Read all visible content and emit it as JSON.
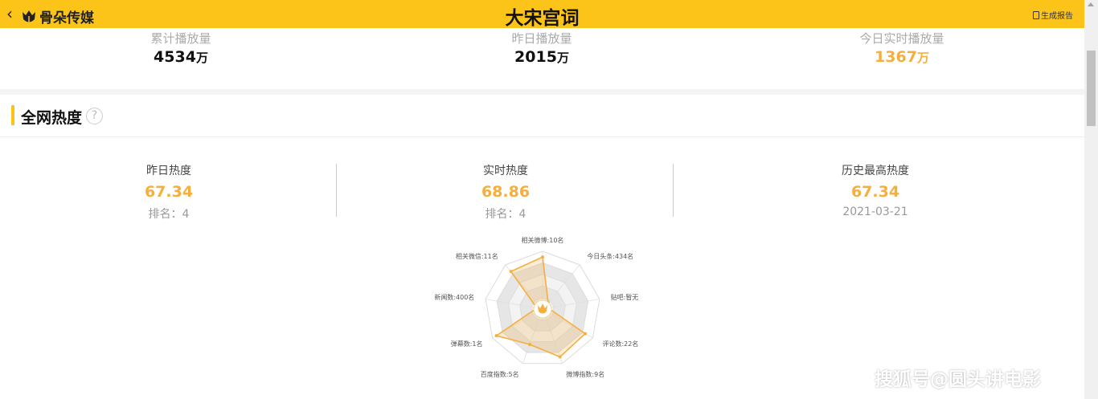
{
  "header": {
    "back_glyph": "‹",
    "brand": "骨朵传媒",
    "title": "大宋宫词",
    "report_label": "生成报告"
  },
  "stats": [
    {
      "label": "累计播放量",
      "value": "4534",
      "unit": "万",
      "accent": false
    },
    {
      "label": "昨日播放量",
      "value": "2015",
      "unit": "万",
      "accent": false
    },
    {
      "label": "今日实时播放量",
      "value": "1367",
      "unit": "万",
      "accent": true
    }
  ],
  "heat": {
    "title": "全网热度",
    "help_glyph": "?",
    "metrics": [
      {
        "label": "昨日热度",
        "value": "67.34",
        "sub": "排名：4"
      },
      {
        "label": "实时热度",
        "value": "68.86",
        "sub": "排名：4"
      },
      {
        "label": "历史最高热度",
        "value": "67.34",
        "sub": "2021-03-21"
      }
    ]
  },
  "chart_data": {
    "type": "radar",
    "axes": [
      "相关微博:10名",
      "今日头条:434名",
      "贴吧:暂无",
      "评论数:22名",
      "微博指数:9名",
      "百度指数:5名",
      "弹幕数:1名",
      "新闻数:400名",
      "相关微信:11名"
    ],
    "values": [
      0.9,
      0.15,
      0.1,
      0.85,
      0.88,
      0.65,
      0.92,
      0.1,
      0.85
    ],
    "colors": {
      "line": "#f6ae3f",
      "fill": "rgba(246,174,63,0.22)"
    }
  },
  "colors": {
    "brand": "#fcc419",
    "accent": "#f6ae3f"
  },
  "watermark": "搜狐号@圆头讲电影"
}
